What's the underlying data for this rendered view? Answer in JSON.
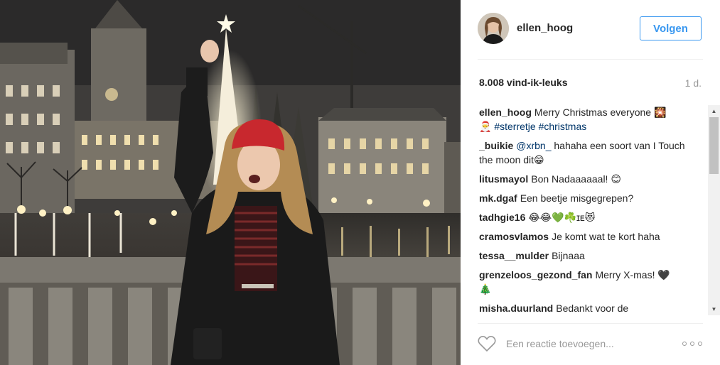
{
  "header": {
    "username": "ellen_hoog",
    "follow_label": "Volgen"
  },
  "stats": {
    "likes": "8.008 vind-ik-leuks",
    "age": "1 d."
  },
  "comments": [
    {
      "user": "ellen_hoog",
      "text": "Merry Christmas everyone 🎇",
      "text2": "🎅",
      "tags": "#sterretje #christmas"
    },
    {
      "user": "_buikie",
      "mention": "@xrbn_",
      "text": "hahaha een soort van I Touch the moon dit😁"
    },
    {
      "user": "litusmayol",
      "text": "Bon Nadaaaaaal! 😊"
    },
    {
      "user": "mk.dgaf",
      "text": "Een beetje misgegrepen?"
    },
    {
      "user": "tadhgie16",
      "text": "😂😂💚☘️ɪᴇ😻"
    },
    {
      "user": "cramosvlamos",
      "text": "Je komt wat te kort haha"
    },
    {
      "user": "tessa__mulder",
      "text": "Bijnaaa"
    },
    {
      "user": "grenzeloos_gezond_fan",
      "text": "Merry X-mas! 🖤",
      "text2": "🎄"
    },
    {
      "user": "misha.duurland",
      "text": "Bedankt voor de"
    }
  ],
  "footer": {
    "comment_placeholder": "Een reactie toevoegen..."
  },
  "icons": {
    "like": "heart-icon",
    "more": "more-options-icon"
  },
  "colors": {
    "accent": "#3897f0",
    "hashtag": "#003569",
    "muted": "#999999"
  }
}
